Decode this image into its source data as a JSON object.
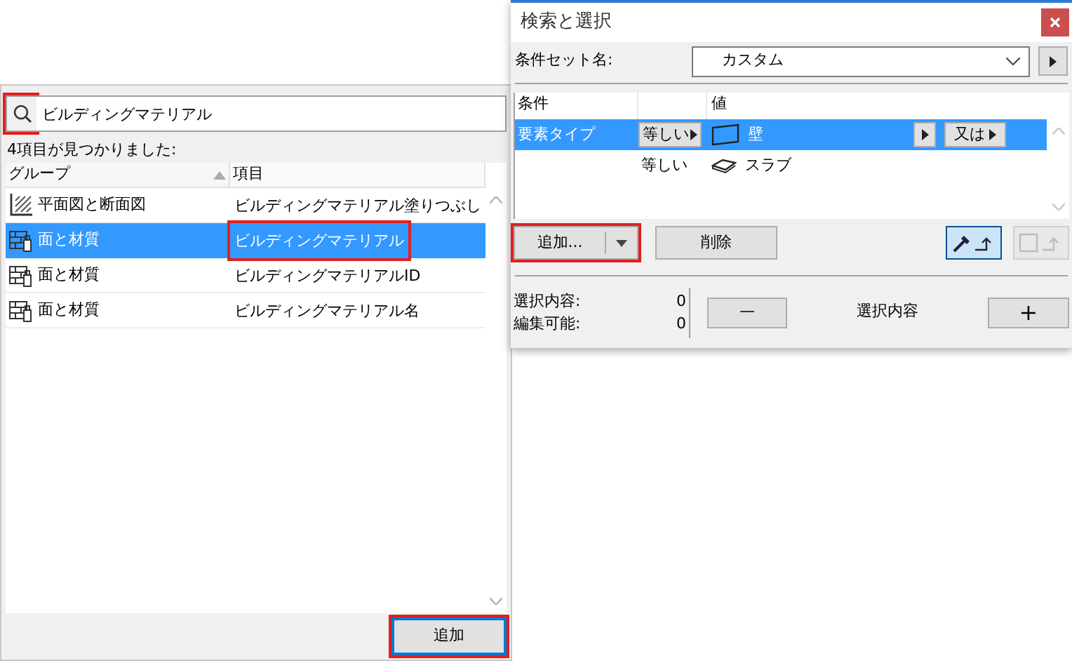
{
  "search_panel": {
    "search": {
      "value": "ビルディングマテリアル",
      "highlighted": true
    },
    "result_count": "4項目が見つかりました:",
    "columns": [
      {
        "label": "グループ",
        "sorted": true
      },
      {
        "label": "項目",
        "sorted": false
      }
    ],
    "rows": [
      {
        "group": "平面図と断面図",
        "kind": "hatch",
        "item": "ビルディングマテリアル塗りつぶし",
        "selected": false,
        "highlighted": false
      },
      {
        "group": "面と材質",
        "kind": "material",
        "item": "ビルディングマテリアル",
        "selected": true,
        "highlighted": true
      },
      {
        "group": "面と材質",
        "kind": "material",
        "item": "ビルディングマテリアルID",
        "selected": false,
        "highlighted": false
      },
      {
        "group": "面と材質",
        "kind": "material",
        "item": "ビルディングマテリアル名",
        "selected": false,
        "highlighted": false
      }
    ],
    "add_button": {
      "label": "追加",
      "highlighted": true
    }
  },
  "dialog": {
    "title": "検索と選択",
    "criteria_set": {
      "label": "条件セット名:",
      "value": "カスタム"
    },
    "columns": [
      "条件",
      "値"
    ],
    "rows": [
      {
        "criterion": "要素タイプ",
        "operator": "等しい",
        "operator_button": true,
        "kind": "wall",
        "value": "壁",
        "or_label": "又は",
        "selected": true
      },
      {
        "operator": "等しい",
        "operator_button": false,
        "kind": "slab",
        "value": "スラブ",
        "selected": false
      }
    ],
    "add_button": {
      "label": "追加...",
      "highlighted": true
    },
    "delete_button": "削除",
    "tools": [
      {
        "kind": "eyedropper",
        "selected": true,
        "disabled": false
      },
      {
        "kind": "marquee",
        "selected": false,
        "disabled": true
      }
    ],
    "stats": [
      {
        "label": "選択内容:",
        "value": "0"
      },
      {
        "label": "編集可能:",
        "value": "0"
      }
    ],
    "minus_button": "—",
    "selection_label": "選択内容",
    "plus_button": "+"
  }
}
